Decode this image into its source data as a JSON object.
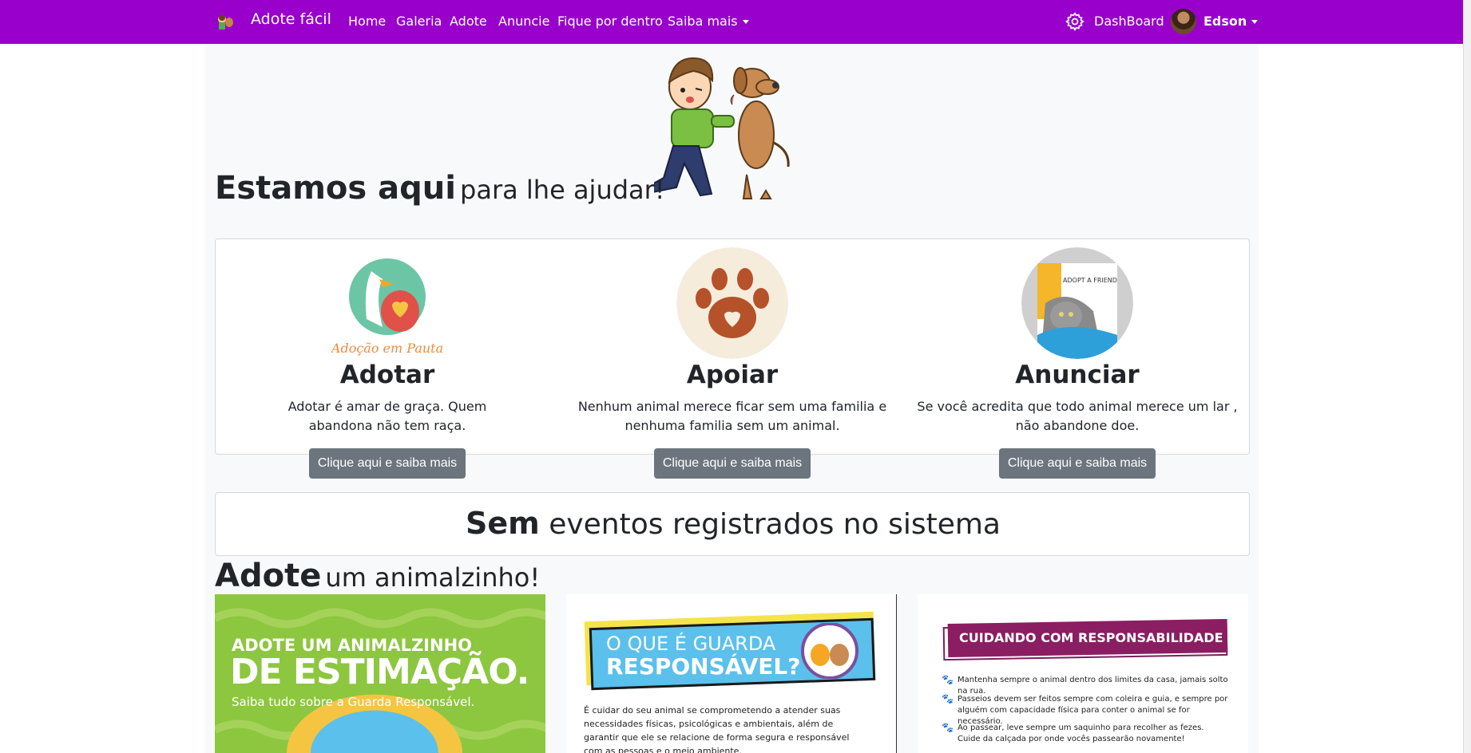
{
  "navbar": {
    "brand": "Adote fácil",
    "links": [
      "Home",
      "Galeria",
      "Adote",
      "Anuncie",
      "Fique por dentro",
      "Saiba mais"
    ],
    "dashboard": "DashBoard",
    "user": "Edson",
    "background": "#9900cc"
  },
  "hero_heading": {
    "big": "Estamos aqui",
    "small": "para lhe ajudar!"
  },
  "features": [
    {
      "title": "Adotar",
      "text": "Adotar é amar de graça. Quem abandona não tem raça.",
      "image_caption": "Adoção em Pauta",
      "button": "Clique aqui e saiba mais"
    },
    {
      "title": "Apoiar",
      "text": "Nenhum animal merece ficar sem uma familia e nenhuma familia sem um animal.",
      "button": "Clique aqui e saiba mais"
    },
    {
      "title": "Anunciar",
      "text": "Se você acredita que todo animal merece um lar , não abandone doe.",
      "image_caption": "ADOPT A FRIEND",
      "button": "Clique aqui e saiba mais"
    }
  ],
  "events": {
    "big": "Sem",
    "small": "eventos registrados no sistema"
  },
  "adopt_heading": {
    "big": "Adote",
    "small": "um animalzinho!"
  },
  "tiles": {
    "tile1": {
      "line1": "ADOTE UM ANIMALZINHO",
      "line2": "DE ESTIMAÇÃO.",
      "line3": "Saiba tudo sobre a Guarda Responsável."
    },
    "tile2": {
      "line1": "O QUE É GUARDA",
      "line2": "RESPONSÁVEL?",
      "body": "É cuidar do seu animal se comprometendo a atender suas necessidades físicas, psicológicas e ambientais, além de garantir que ele se relacione de forma segura e responsável com as pessoas e o meio ambiente."
    },
    "tile3": {
      "title": "CUIDANDO COM RESPONSABILIDADE",
      "items": [
        "Mantenha sempre o animal dentro dos limites da casa, jamais solto na rua.",
        "Passeios devem ser feitos sempre com coleira e guia, e sempre por alguém com capacidade física para conter o animal se for necessário.",
        "Ao passear, leve sempre um saquinho para recolher as fezes. Cuide da calçada por onde vocês passearão novamente!"
      ]
    }
  }
}
